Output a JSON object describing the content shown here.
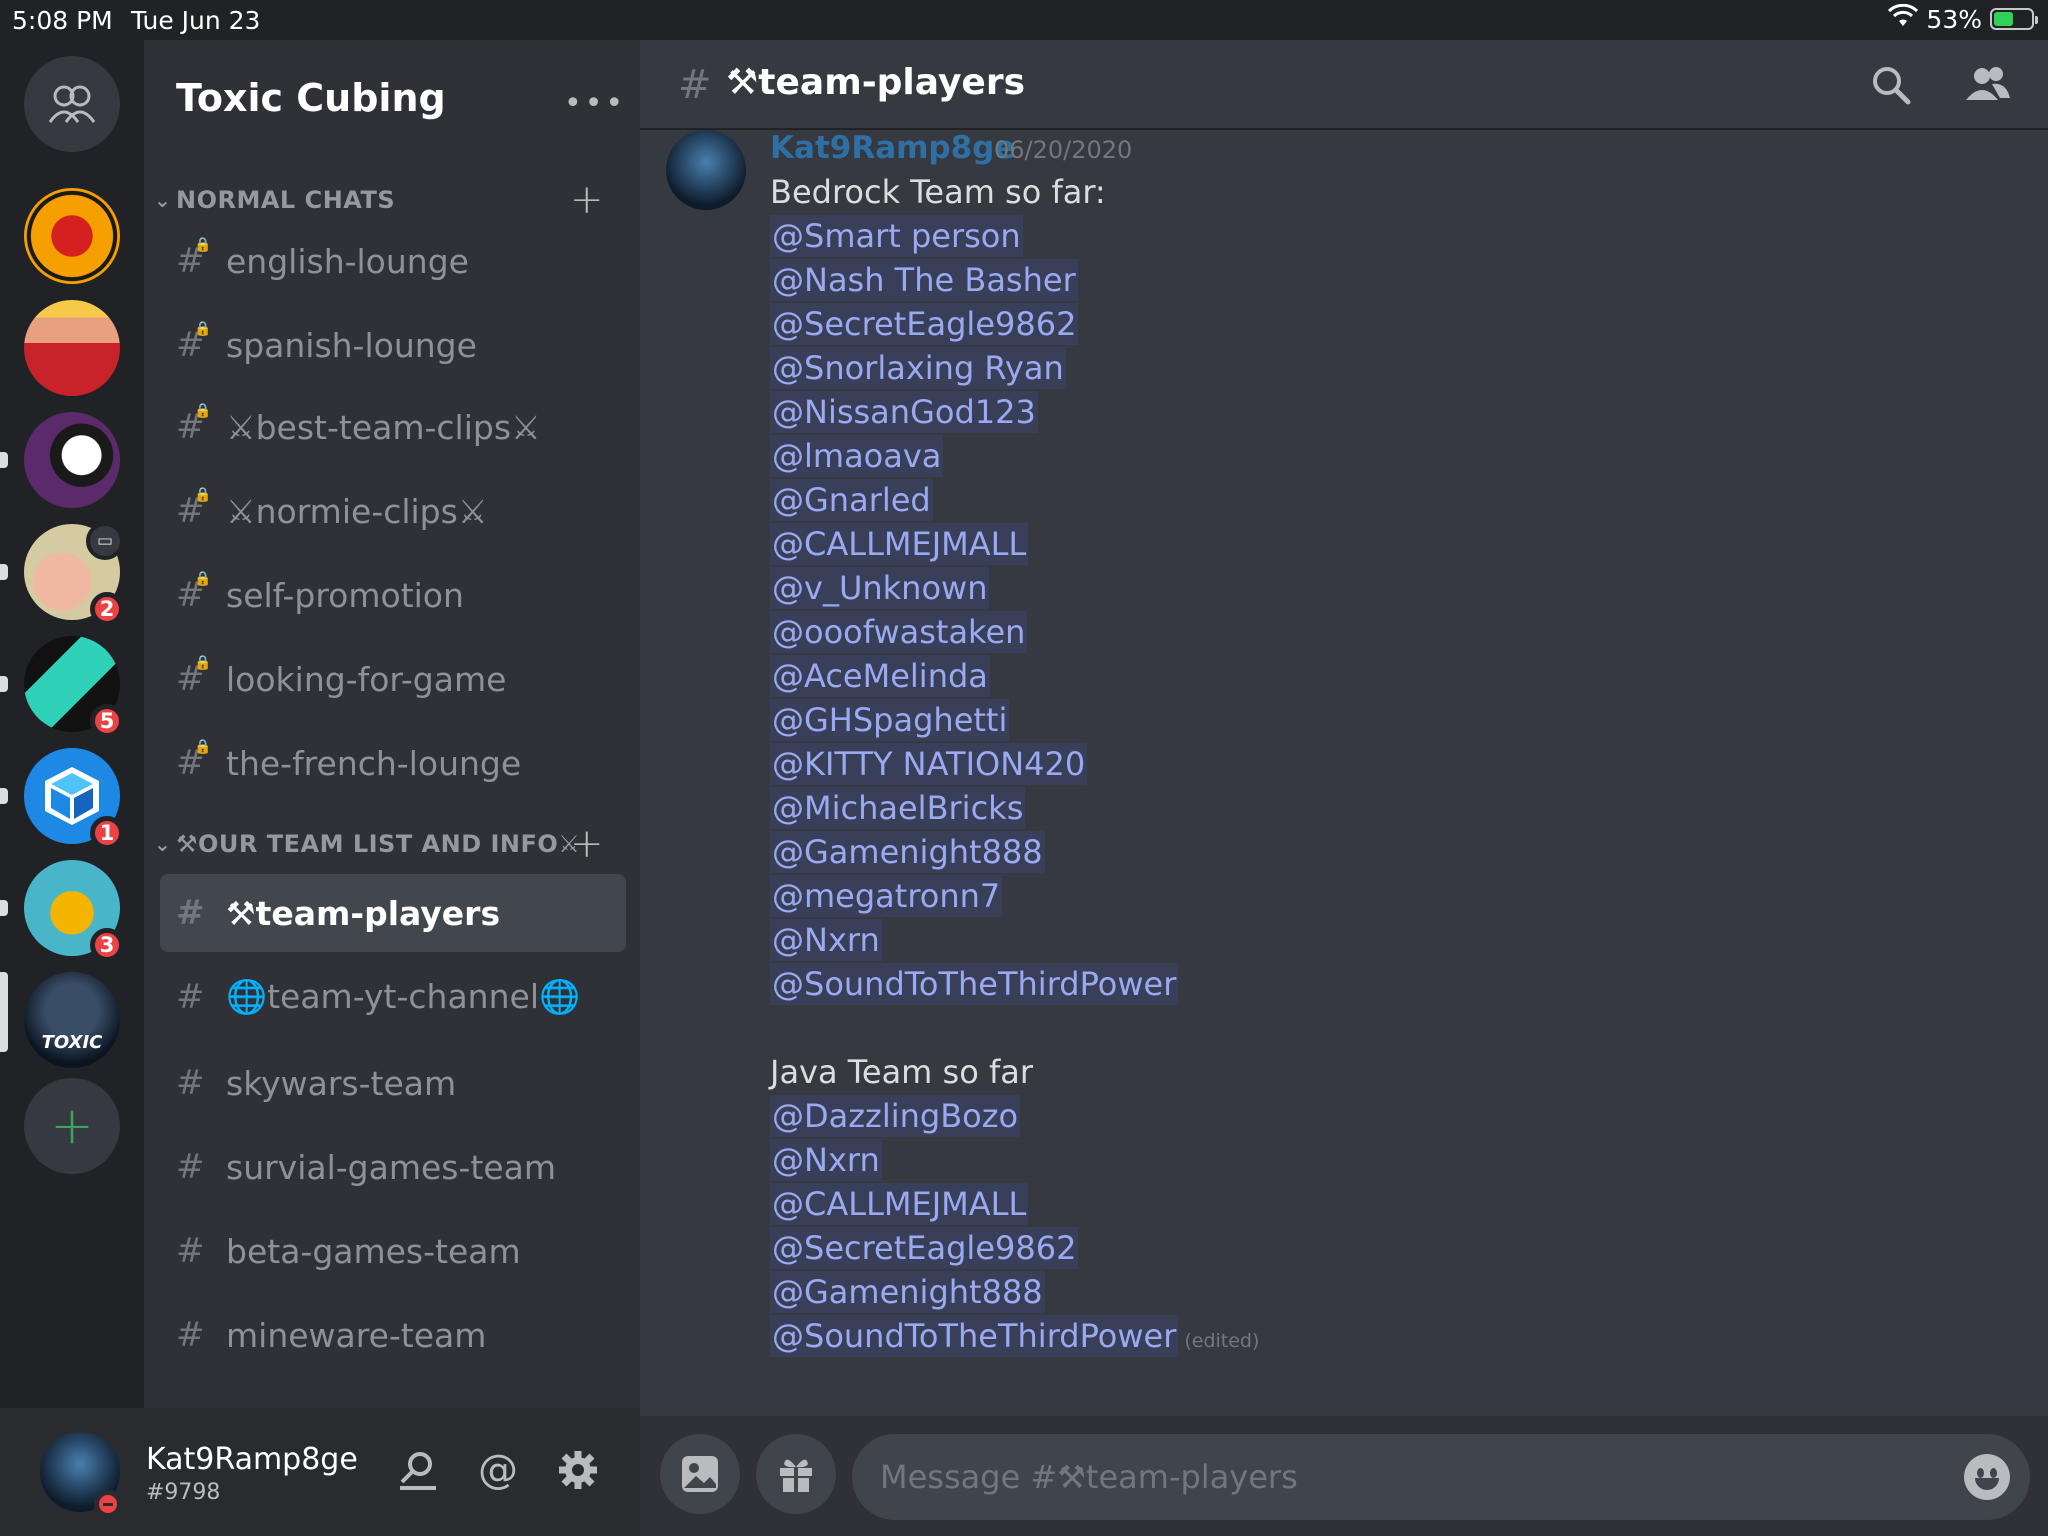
{
  "status_bar": {
    "time": "5:08 PM",
    "date": "Tue Jun 23",
    "battery": "53%"
  },
  "server_rail": {
    "servers": [
      {
        "badge": ""
      },
      {
        "badge": ""
      },
      {
        "badge": ""
      },
      {
        "badge": "2"
      },
      {
        "badge": "5"
      },
      {
        "badge": "1"
      },
      {
        "badge": "3"
      },
      {
        "badge": "",
        "label": "TOXIC"
      }
    ]
  },
  "sidebar": {
    "server_name": "Toxic Cubing",
    "categories": [
      {
        "name": "NORMAL CHATS"
      },
      {
        "name": "⚒OUR TEAM LIST AND INFO⚔"
      }
    ],
    "channels": [
      {
        "name": "english-lounge",
        "locked": true
      },
      {
        "name": "spanish-lounge",
        "locked": true
      },
      {
        "name": "⚔best-team-clips⚔",
        "locked": true
      },
      {
        "name": "⚔normie-clips⚔",
        "locked": true
      },
      {
        "name": "self-promotion",
        "locked": true
      },
      {
        "name": "looking-for-game",
        "locked": true
      },
      {
        "name": "the-french-lounge",
        "locked": true
      },
      {
        "name": "⚒team-players",
        "locked": false,
        "active": true
      },
      {
        "name": "🌐team-yt-channel🌐",
        "locked": false
      },
      {
        "name": "skywars-team",
        "locked": false
      },
      {
        "name": "survial-games-team",
        "locked": false
      },
      {
        "name": "beta-games-team",
        "locked": false
      },
      {
        "name": "mineware-team",
        "locked": false
      }
    ]
  },
  "user_panel": {
    "username": "Kat9Ramp8ge",
    "tag": "#9798"
  },
  "header": {
    "channel": "⚒team-players"
  },
  "message": {
    "author": "Kat9Ramp8ge",
    "timestamp": "06/20/2020",
    "edited": "(edited)",
    "lines": [
      {
        "text": "Bedrock Team so far:",
        "mention": false
      },
      {
        "text": "@Smart person",
        "mention": true
      },
      {
        "text": "@Nash The Basher",
        "mention": true
      },
      {
        "text": "@SecretEagle9862",
        "mention": true
      },
      {
        "text": "@Snorlaxing Ryan",
        "mention": true
      },
      {
        "text": "@NissanGod123",
        "mention": true
      },
      {
        "text": "@lmaoava",
        "mention": true
      },
      {
        "text": "@Gnarled",
        "mention": true
      },
      {
        "text": "@CALLMEJMALL",
        "mention": true
      },
      {
        "text": "@v_Unknown",
        "mention": true
      },
      {
        "text": "@ooofwastaken",
        "mention": true
      },
      {
        "text": "@AceMelinda",
        "mention": true
      },
      {
        "text": "@GHSpaghetti",
        "mention": true
      },
      {
        "text": "@KITTY NATION420",
        "mention": true
      },
      {
        "text": "@MichaelBricks",
        "mention": true
      },
      {
        "text": "@Gamenight888",
        "mention": true
      },
      {
        "text": "@megatronn7",
        "mention": true
      },
      {
        "text": "@Nxrn",
        "mention": true
      },
      {
        "text": "@SoundToTheThirdPower",
        "mention": true
      },
      {
        "text": "",
        "mention": false
      },
      {
        "text": "Java Team so far",
        "mention": false
      },
      {
        "text": "@DazzlingBozo",
        "mention": true
      },
      {
        "text": "@Nxrn",
        "mention": true
      },
      {
        "text": "@CALLMEJMALL",
        "mention": true
      },
      {
        "text": "@SecretEagle9862",
        "mention": true
      },
      {
        "text": "@Gamenight888",
        "mention": true
      },
      {
        "text": "@SoundToTheThirdPower",
        "mention": true,
        "edited": true
      }
    ]
  },
  "composer": {
    "placeholder": "Message #⚒team-players"
  },
  "colors": {
    "accent": "#5865f2",
    "mention_text": "#99aaf0",
    "badge": "#ed4245",
    "online_green": "#3ba55d"
  }
}
